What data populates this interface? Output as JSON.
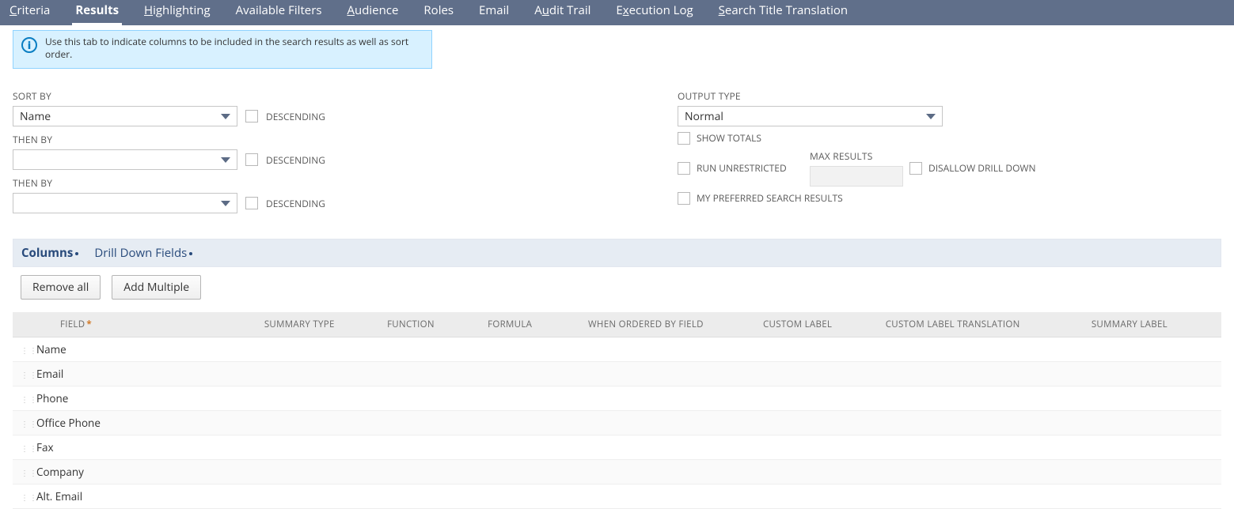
{
  "tabs": {
    "criteria": "Criteria",
    "results": "Results",
    "highlighting": "Highlighting",
    "available_filters": "Available Filters",
    "audience": "Audience",
    "roles": "Roles",
    "email": "Email",
    "audit_trail": "Audit Trail",
    "execution_log": "Execution Log",
    "search_title_translation": "Search Title Translation"
  },
  "info": {
    "message": "Use this tab to indicate columns to be included in the search results as well as sort order."
  },
  "sort": {
    "sort_by_label": "SORT BY",
    "then_by_label": "THEN BY",
    "descending_label": "DESCENDING",
    "sort1_value": "Name",
    "sort2_value": "",
    "sort3_value": ""
  },
  "output": {
    "type_label": "OUTPUT TYPE",
    "type_value": "Normal",
    "show_totals_label": "SHOW TOTALS",
    "run_unrestricted_label": "RUN UNRESTRICTED",
    "max_results_label": "MAX RESULTS",
    "disallow_drilldown_label": "DISALLOW DRILL DOWN",
    "preferred_label": "MY PREFERRED SEARCH RESULTS"
  },
  "subtabs": {
    "columns": "Columns",
    "drill_down_fields": "Drill Down Fields"
  },
  "buttons": {
    "remove_all": "Remove all",
    "add_multiple": "Add Multiple"
  },
  "table": {
    "headers": {
      "field": "FIELD",
      "summary_type": "SUMMARY TYPE",
      "function": "FUNCTION",
      "formula": "FORMULA",
      "when_ordered_by_field": "WHEN ORDERED BY FIELD",
      "custom_label": "CUSTOM LABEL",
      "custom_label_translation": "CUSTOM LABEL TRANSLATION",
      "summary_label": "SUMMARY LABEL"
    },
    "rows": [
      {
        "field": "Name"
      },
      {
        "field": "Email"
      },
      {
        "field": "Phone"
      },
      {
        "field": "Office Phone"
      },
      {
        "field": "Fax"
      },
      {
        "field": "Company"
      },
      {
        "field": "Alt. Email"
      }
    ]
  }
}
